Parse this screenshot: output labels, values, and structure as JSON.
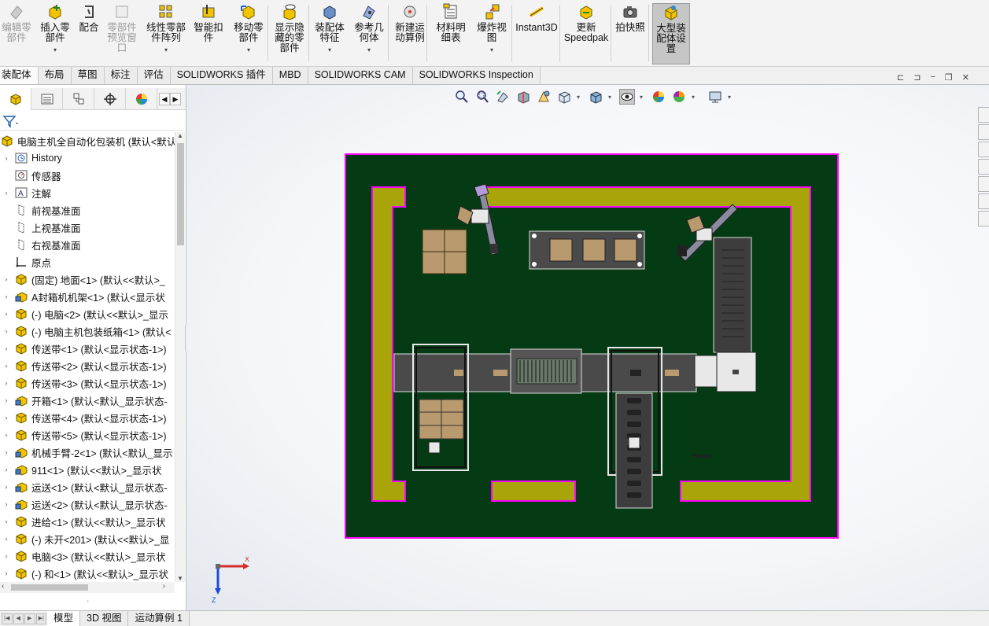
{
  "ribbon": {
    "buttons": [
      {
        "id": "edit-component",
        "label": "编辑零\n部件",
        "disabled": true,
        "icon": "edit-component-icon"
      },
      {
        "id": "insert-component",
        "label": "插入零\n部件",
        "disabled": false,
        "icon": "insert-component-icon"
      },
      {
        "id": "mate",
        "label": "配合",
        "disabled": false,
        "icon": "mate-icon"
      },
      {
        "id": "component-preview",
        "label": "零部件\n预览窗\n口",
        "disabled": true,
        "icon": "preview-window-icon"
      },
      {
        "id": "linear-pattern",
        "label": "线性零部\n件阵列",
        "disabled": false,
        "icon": "linear-pattern-icon"
      },
      {
        "id": "smart-fasteners",
        "label": "智能扣\n件",
        "disabled": false,
        "icon": "smart-fasteners-icon"
      },
      {
        "id": "move-component",
        "label": "移动零\n部件",
        "disabled": false,
        "icon": "move-component-icon"
      },
      {
        "id": "show-hidden",
        "label": "显示隐\n藏的零\n部件",
        "disabled": false,
        "icon": "show-hidden-icon"
      },
      {
        "id": "assembly-features",
        "label": "装配体\n特征",
        "disabled": false,
        "icon": "assembly-features-icon"
      },
      {
        "id": "reference-geometry",
        "label": "参考几\n何体",
        "disabled": false,
        "icon": "reference-geometry-icon"
      },
      {
        "id": "new-motion-study",
        "label": "新建运\n动算例",
        "disabled": false,
        "icon": "motion-study-icon"
      },
      {
        "id": "bom",
        "label": "材料明\n细表",
        "disabled": false,
        "icon": "bom-icon"
      },
      {
        "id": "exploded-view",
        "label": "爆炸视\n图",
        "disabled": false,
        "icon": "exploded-view-icon"
      },
      {
        "id": "instant3d",
        "label": "Instant3D",
        "disabled": false,
        "icon": "instant3d-icon"
      },
      {
        "id": "update-speedpak",
        "label": "更新\nSpeedpak",
        "disabled": false,
        "icon": "speedpak-icon"
      },
      {
        "id": "snapshot",
        "label": "拍快照",
        "disabled": false,
        "icon": "camera-icon"
      },
      {
        "id": "large-assembly",
        "label": "大型装\n配体设\n置",
        "disabled": false,
        "icon": "large-assembly-icon"
      }
    ]
  },
  "command_tabs": [
    "装配体",
    "布局",
    "草图",
    "标注",
    "评估",
    "SOLIDWORKS 插件",
    "MBD",
    "SOLIDWORKS CAM",
    "SOLIDWORKS Inspection"
  ],
  "tree": {
    "root": "电脑主机全自动化包装机 (默认<默认",
    "items": [
      {
        "label": "History",
        "icon": "history-icon",
        "expand": true
      },
      {
        "label": "传感器",
        "icon": "sensor-icon",
        "expand": false
      },
      {
        "label": "注解",
        "icon": "annotation-icon",
        "expand": true
      },
      {
        "label": "前视基准面",
        "icon": "plane-icon",
        "expand": false
      },
      {
        "label": "上视基准面",
        "icon": "plane-icon",
        "expand": false
      },
      {
        "label": "右视基准面",
        "icon": "plane-icon",
        "expand": false
      },
      {
        "label": "原点",
        "icon": "origin-icon",
        "expand": false
      },
      {
        "label": "(固定) 地面<1> (默认<<默认>_",
        "icon": "part-icon",
        "expand": true
      },
      {
        "label": "A封箱机机架<1> (默认<显示状",
        "icon": "subassembly-icon",
        "expand": true
      },
      {
        "label": "(-) 电脑<2> (默认<<默认>_显示",
        "icon": "part-icon",
        "expand": true
      },
      {
        "label": "(-) 电脑主机包装纸箱<1> (默认<",
        "icon": "part-icon",
        "expand": true
      },
      {
        "label": "传送带<1> (默认<显示状态-1>)",
        "icon": "part-icon",
        "expand": true
      },
      {
        "label": "传送带<2> (默认<显示状态-1>)",
        "icon": "part-icon",
        "expand": true
      },
      {
        "label": "传送带<3> (默认<显示状态-1>)",
        "icon": "part-icon",
        "expand": true
      },
      {
        "label": "开箱<1> (默认<默认_显示状态-",
        "icon": "subassembly-icon",
        "expand": true
      },
      {
        "label": "传送带<4> (默认<显示状态-1>)",
        "icon": "part-icon",
        "expand": true
      },
      {
        "label": "传送带<5> (默认<显示状态-1>)",
        "icon": "part-icon",
        "expand": true
      },
      {
        "label": "机械手臂-2<1> (默认<默认_显示",
        "icon": "subassembly-icon",
        "expand": true
      },
      {
        "label": "911<1> (默认<<默认>_显示状",
        "icon": "subassembly-icon",
        "expand": true
      },
      {
        "label": "运送<1> (默认<默认_显示状态-",
        "icon": "subassembly-icon",
        "expand": true
      },
      {
        "label": "运送<2> (默认<默认_显示状态-",
        "icon": "subassembly-icon",
        "expand": true
      },
      {
        "label": "进给<1> (默认<<默认>_显示状",
        "icon": "part-icon",
        "expand": true
      },
      {
        "label": "(-) 未开<201> (默认<<默认>_显",
        "icon": "part-icon",
        "expand": true
      },
      {
        "label": "电脑<3> (默认<<默认>_显示状",
        "icon": "part-icon",
        "expand": true
      },
      {
        "label": "(-) 和<1> (默认<<默认>_显示状",
        "icon": "part-icon",
        "expand": true
      }
    ]
  },
  "bottom_tabs": [
    "模型",
    "3D 视图",
    "运动算例 1"
  ],
  "triad": {
    "x": "X",
    "z": "Z"
  },
  "colors": {
    "floor": "#053b14",
    "rail": "#a8a40a",
    "edge": "#ff00ff",
    "conveyor": "#4a4a4a",
    "box": "#b89a6e"
  }
}
